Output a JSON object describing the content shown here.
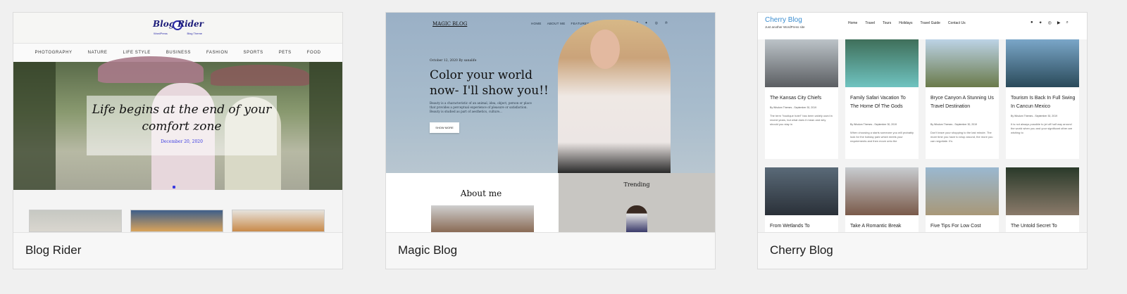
{
  "cards": [
    {
      "name": "Blog Rider",
      "logo_left": "Blog",
      "logo_right": "Rider",
      "logo_sub_left": "WordPress",
      "logo_sub_right": "Blog Theme",
      "nav": [
        "PHOTOGRAPHY",
        "NATURE",
        "LIFE STYLE",
        "BUSINESS",
        "FASHION",
        "SPORTS",
        "PETS",
        "FOOD"
      ],
      "hero_title": "Life begins at the end of your comfort zone",
      "hero_date": "December 20, 2020"
    },
    {
      "name": "Magic Blog",
      "logo": "MAGIC BLOG",
      "nav": [
        "HOME",
        "ABOUT ME",
        "FEATURES",
        "BLOG"
      ],
      "meta": "October 12, 2020  By  sanalife",
      "title": "Color your world now- I'll show you!!",
      "desc": "Beauty is a characteristic of an animal, idea, object, person or place that provides a perceptual experience of pleasure or satisfaction. Beauty is studied as part of aesthetics, culture...",
      "button": "SHOW MORE",
      "about_heading": "About me",
      "trending_heading": "Trending"
    },
    {
      "name": "Cherry Blog",
      "brand": "Cherry Blog",
      "tagline": "Just another WordPress site",
      "nav": [
        "Home",
        "Travel",
        "Tours",
        "Holidays",
        "Travel Guide",
        "Contact Us"
      ],
      "posts_row1": [
        {
          "title": "The Kansas City Chiefs",
          "meta": "By Wisdom Themes  -  September 30, 2019",
          "excerpt": "The term \"boutique hotel\" has been widely used in recent years, but what does it mean and why should you stay in"
        },
        {
          "title": "Family Safari Vacation To The Home Of The Gods",
          "meta": "By Wisdom Themes  -  September 30, 2019",
          "excerpt": "When choosing a starts someone you will probably look for the holiday park which meets your requirements and then move onto the"
        },
        {
          "title": "Bryce Canyon A Stunning Us Travel Destination",
          "meta": "By Wisdom Themes  -  September 30, 2019",
          "excerpt": "Don't leave your shopping to the last minute. The more time you have to shop around, the more you can negotiate. It's"
        },
        {
          "title": "Tourism Is Back In Full Swing In Cancun Mexico",
          "meta": "By Wisdom Themes  -  September 30, 2019",
          "excerpt": "It is not always possible to jet off half way around the world when you and your significant other are wishing to"
        }
      ],
      "posts_row2": [
        {
          "title": "From Wetlands To"
        },
        {
          "title": "Take A Romantic Break"
        },
        {
          "title": "Five Tips For Low Cost"
        },
        {
          "title": "The Untold Secret To"
        }
      ]
    }
  ]
}
